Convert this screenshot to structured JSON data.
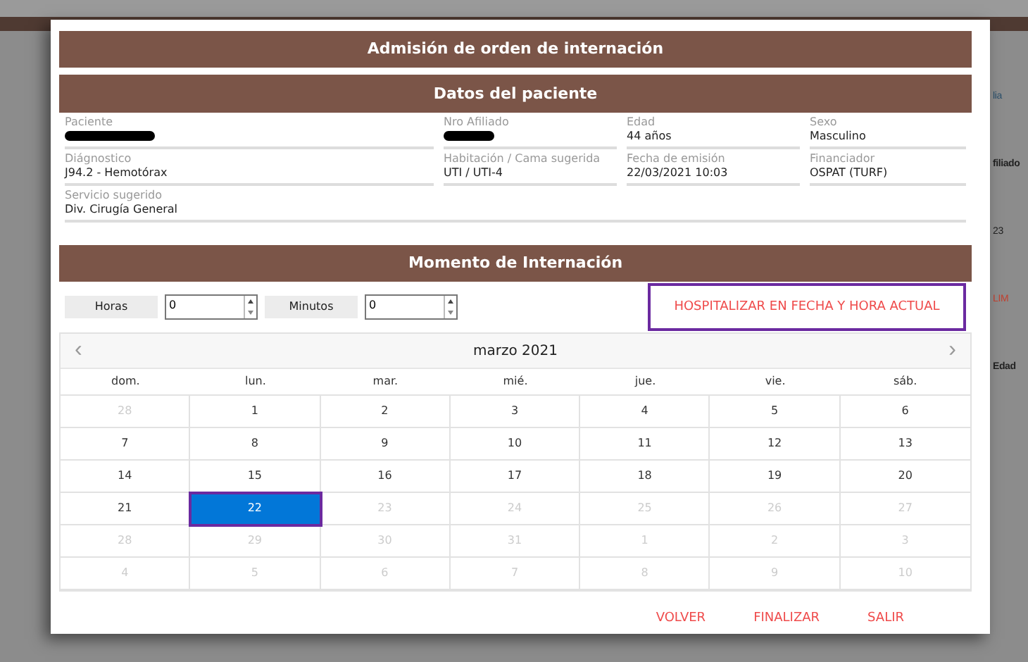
{
  "background": {
    "fragments": [
      {
        "text": "lia",
        "kind": "link"
      },
      {
        "text": "filiado",
        "kind": "heading"
      },
      {
        "text": "23",
        "kind": "plain"
      },
      {
        "text": "LIM",
        "kind": "alert"
      },
      {
        "text": "Edad",
        "kind": "heading"
      }
    ]
  },
  "dialog": {
    "title": "Admisión de orden de internación",
    "patient": {
      "title": "Datos del paciente",
      "rows": [
        [
          {
            "label": "Paciente",
            "redacted": true
          },
          {
            "label": "Nro Afiliado",
            "redacted": true
          },
          {
            "label": "Edad",
            "value": "44 años",
            "redacted": false
          },
          {
            "label": "Sexo",
            "value": "Masculino",
            "redacted": false
          }
        ],
        [
          {
            "label": "Diágnostico",
            "value": "J94.2 - Hemotórax",
            "redacted": false
          },
          {
            "label": "Habitación / Cama sugerida",
            "value": "UTI / UTI-4",
            "redacted": false
          },
          {
            "label": "Fecha de emisión",
            "value": "22/03/2021   10:03",
            "redacted": false
          },
          {
            "label": "Financiador",
            "value": "OSPAT (TURF)",
            "redacted": false
          }
        ],
        [
          {
            "label": "Servicio sugerido",
            "value": "Div. Cirugía General",
            "redacted": false
          }
        ]
      ]
    },
    "moment": {
      "title": "Momento de Internación",
      "spinners": [
        {
          "label": "Horas",
          "value": "0"
        },
        {
          "label": "Minutos",
          "value": "0"
        }
      ],
      "now_button": {
        "label": "HOSPITALIZAR EN FECHA Y HORA ACTUAL",
        "highlighted": true
      },
      "calendar": {
        "month": "marzo 2021",
        "prev": "‹",
        "next": "›",
        "weekdays": [
          "dom.",
          "lun.",
          "mar.",
          "mié.",
          "jue.",
          "vie.",
          "sáb."
        ],
        "weeks": [
          [
            {
              "label": "28",
              "muted": true,
              "selected": false,
              "highlighted": false
            },
            {
              "label": "1",
              "muted": false,
              "selected": false,
              "highlighted": false
            },
            {
              "label": "2",
              "muted": false,
              "selected": false,
              "highlighted": false
            },
            {
              "label": "3",
              "muted": false,
              "selected": false,
              "highlighted": false
            },
            {
              "label": "4",
              "muted": false,
              "selected": false,
              "highlighted": false
            },
            {
              "label": "5",
              "muted": false,
              "selected": false,
              "highlighted": false
            },
            {
              "label": "6",
              "muted": false,
              "selected": false,
              "highlighted": false
            }
          ],
          [
            {
              "label": "7",
              "muted": false,
              "selected": false,
              "highlighted": false
            },
            {
              "label": "8",
              "muted": false,
              "selected": false,
              "highlighted": false
            },
            {
              "label": "9",
              "muted": false,
              "selected": false,
              "highlighted": false
            },
            {
              "label": "10",
              "muted": false,
              "selected": false,
              "highlighted": false
            },
            {
              "label": "11",
              "muted": false,
              "selected": false,
              "highlighted": false
            },
            {
              "label": "12",
              "muted": false,
              "selected": false,
              "highlighted": false
            },
            {
              "label": "13",
              "muted": false,
              "selected": false,
              "highlighted": false
            }
          ],
          [
            {
              "label": "14",
              "muted": false,
              "selected": false,
              "highlighted": false
            },
            {
              "label": "15",
              "muted": false,
              "selected": false,
              "highlighted": false
            },
            {
              "label": "16",
              "muted": false,
              "selected": false,
              "highlighted": false
            },
            {
              "label": "17",
              "muted": false,
              "selected": false,
              "highlighted": false
            },
            {
              "label": "18",
              "muted": false,
              "selected": false,
              "highlighted": false
            },
            {
              "label": "19",
              "muted": false,
              "selected": false,
              "highlighted": false
            },
            {
              "label": "20",
              "muted": false,
              "selected": false,
              "highlighted": false
            }
          ],
          [
            {
              "label": "21",
              "muted": false,
              "selected": false,
              "highlighted": false
            },
            {
              "label": "22",
              "muted": false,
              "selected": true,
              "highlighted": true
            },
            {
              "label": "23",
              "muted": true,
              "selected": false,
              "highlighted": false
            },
            {
              "label": "24",
              "muted": true,
              "selected": false,
              "highlighted": false
            },
            {
              "label": "25",
              "muted": true,
              "selected": false,
              "highlighted": false
            },
            {
              "label": "26",
              "muted": true,
              "selected": false,
              "highlighted": false
            },
            {
              "label": "27",
              "muted": true,
              "selected": false,
              "highlighted": false
            }
          ],
          [
            {
              "label": "28",
              "muted": true,
              "selected": false,
              "highlighted": false
            },
            {
              "label": "29",
              "muted": true,
              "selected": false,
              "highlighted": false
            },
            {
              "label": "30",
              "muted": true,
              "selected": false,
              "highlighted": false
            },
            {
              "label": "31",
              "muted": true,
              "selected": false,
              "highlighted": false
            },
            {
              "label": "1",
              "muted": true,
              "selected": false,
              "highlighted": false
            },
            {
              "label": "2",
              "muted": true,
              "selected": false,
              "highlighted": false
            },
            {
              "label": "3",
              "muted": true,
              "selected": false,
              "highlighted": false
            }
          ],
          [
            {
              "label": "4",
              "muted": true,
              "selected": false,
              "highlighted": false
            },
            {
              "label": "5",
              "muted": true,
              "selected": false,
              "highlighted": false
            },
            {
              "label": "6",
              "muted": true,
              "selected": false,
              "highlighted": false
            },
            {
              "label": "7",
              "muted": true,
              "selected": false,
              "highlighted": false
            },
            {
              "label": "8",
              "muted": true,
              "selected": false,
              "highlighted": false
            },
            {
              "label": "9",
              "muted": true,
              "selected": false,
              "highlighted": false
            },
            {
              "label": "10",
              "muted": true,
              "selected": false,
              "highlighted": false
            }
          ]
        ]
      }
    },
    "buttons": [
      "VOLVER",
      "FINALIZAR",
      "SALIR"
    ]
  }
}
